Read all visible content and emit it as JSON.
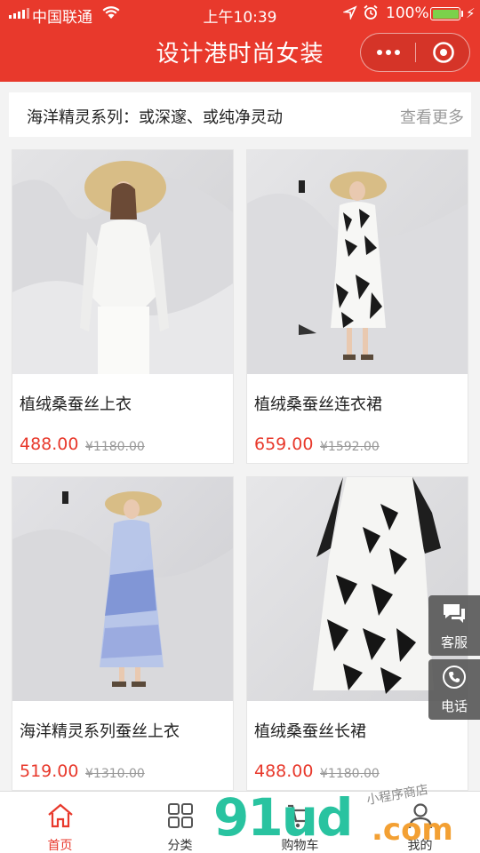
{
  "status_bar": {
    "carrier": "中国联通",
    "time": "上午10:39",
    "battery": "100%",
    "battery_level": 1.0,
    "icons": [
      "signal-icon",
      "wifi-icon",
      "location-icon",
      "alarm-icon",
      "battery-icon",
      "charging-icon"
    ]
  },
  "header": {
    "title": "设计港时尚女装",
    "accent_color": "#e8392c",
    "capsule_icons": [
      "more-icon",
      "close-icon"
    ]
  },
  "section": {
    "title": "海洋精灵系列：或深邃、或纯净灵动",
    "more_label": "查看更多"
  },
  "products": [
    {
      "name": "植绒桑蚕丝上衣",
      "price": "488.00",
      "original_price": "¥1180.00"
    },
    {
      "name": "植绒桑蚕丝连衣裙",
      "price": "659.00",
      "original_price": "¥1592.00"
    },
    {
      "name": "海洋精灵系列蚕丝上衣",
      "price": "519.00",
      "original_price": "¥1310.00"
    },
    {
      "name": "植绒桑蚕丝长裙",
      "price": "488.00",
      "original_price": "¥1180.00"
    }
  ],
  "floating": {
    "service_label": "客服",
    "phone_label": "电话"
  },
  "tabbar": {
    "tabs": [
      {
        "label": "首页",
        "icon": "home-icon",
        "active": true
      },
      {
        "label": "分类",
        "icon": "grid-icon",
        "active": false
      },
      {
        "label": "购物车",
        "icon": "cart-icon",
        "active": false
      },
      {
        "label": "我的",
        "icon": "user-icon",
        "active": false
      }
    ]
  },
  "watermark": {
    "main": "91ud",
    "domain": ".com",
    "tagline": "小程序商店"
  }
}
